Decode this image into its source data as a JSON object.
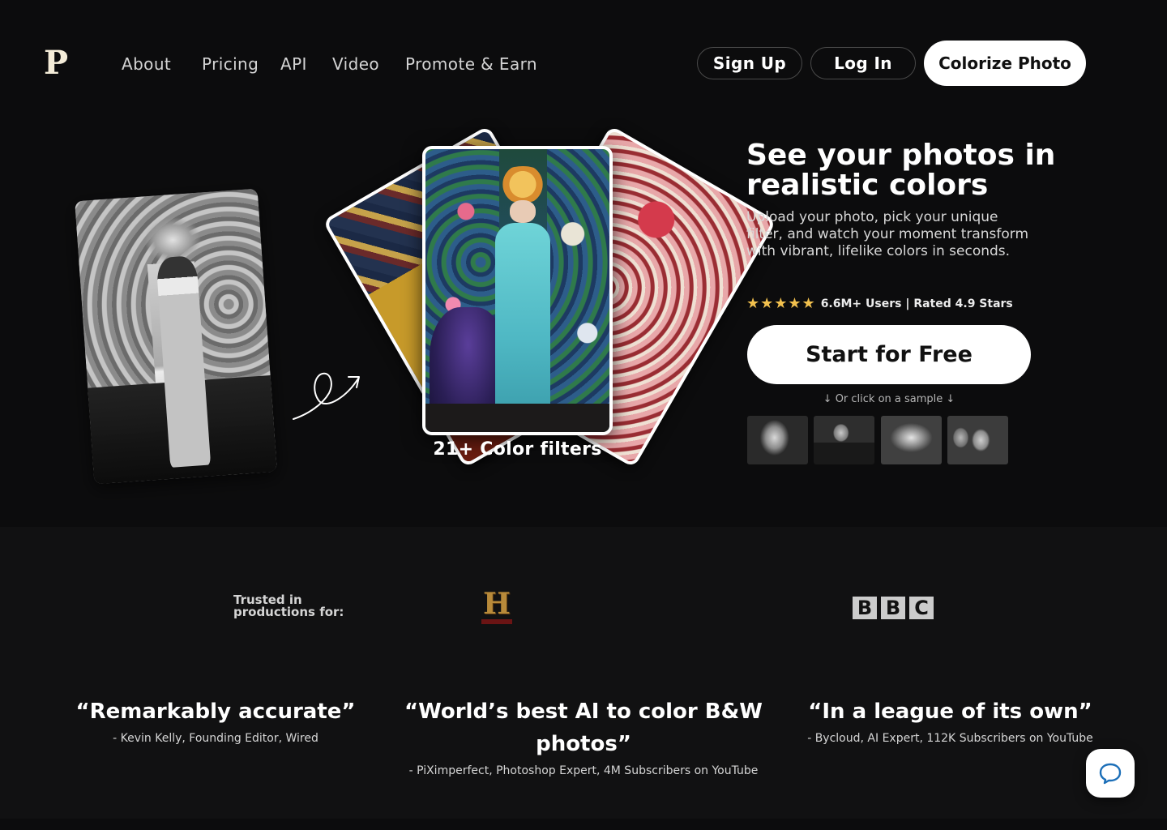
{
  "brand": {
    "logo_letter": "P"
  },
  "nav": {
    "links": [
      "About",
      "Pricing",
      "API",
      "Video",
      "Promote & Earn"
    ],
    "sign_up": "Sign Up",
    "log_in": "Log In",
    "cta": "Colorize Photo"
  },
  "hero": {
    "title": "See your photos in realistic colors",
    "subtitle": "Upload your photo, pick your unique filter, and watch your moment transform with vibrant, lifelike colors in seconds.",
    "stars": "★★★★★",
    "rating_text": "6.6M+ Users | Rated 4.9 Stars",
    "rating_value": 4.9,
    "cta": "Start for Free",
    "sample_hint": "↓ Or click on a sample ↓",
    "filters_caption": "21+ Color filters"
  },
  "trusted": {
    "label": "Trusted in productions for:",
    "logos": [
      {
        "name": "History",
        "mark": "H"
      },
      {
        "name": "BBC",
        "letters": [
          "B",
          "B",
          "C"
        ]
      }
    ]
  },
  "quotes": [
    {
      "text": "“Remarkably accurate”",
      "author": "- Kevin Kelly, Founding Editor, Wired"
    },
    {
      "text": "“World’s best AI to color B&W photos”",
      "author": "- PiXimperfect, Photoshop Expert, 4M Subscribers on YouTube"
    },
    {
      "text": "“In a league of its own”",
      "author": "- Bycloud, AI Expert, 112K Subscribers on YouTube"
    }
  ],
  "colors": {
    "background": "#0c0c0d",
    "accent_star": "#f2c14e",
    "button_bg": "#ffffff",
    "button_text": "#111111"
  },
  "icons": {
    "chat": "chat-bubble-icon",
    "arrow": "curly-arrow-icon"
  }
}
